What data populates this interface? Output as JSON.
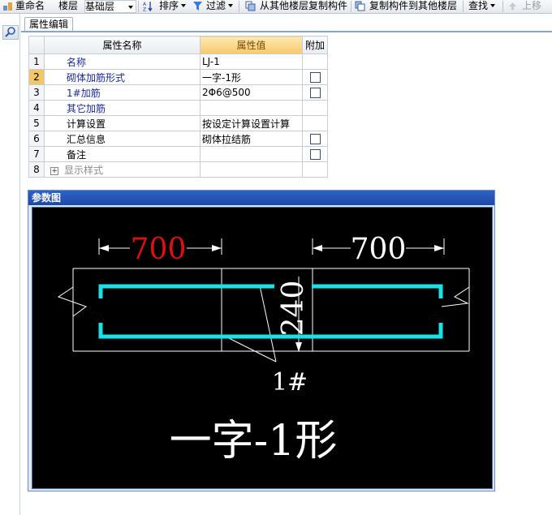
{
  "toolbar": {
    "rename": "重命名",
    "floor_label": "楼层",
    "floor_value": "基础层",
    "sort": "排序",
    "filter": "过滤",
    "copy_from": "从其他楼层复制构件",
    "copy_to": "复制构件到其他楼层",
    "find": "查找",
    "move_up": "上移"
  },
  "tab": {
    "label": "属性编辑"
  },
  "grid": {
    "headers": {
      "name": "属性名称",
      "value": "属性值",
      "extra": "附加"
    },
    "rows": [
      {
        "num": "1",
        "name": "名称",
        "value": "LJ-1",
        "extra": false
      },
      {
        "num": "2",
        "name": "砌体加筋形式",
        "value": "一字-1形",
        "extra": true
      },
      {
        "num": "3",
        "name": "1#加筋",
        "value": "2Φ6@500",
        "extra": true
      },
      {
        "num": "4",
        "name": "其它加筋",
        "value": "",
        "extra": false
      },
      {
        "num": "5",
        "name": "计算设置",
        "value": "按设定计算设置计算",
        "extra": false
      },
      {
        "num": "6",
        "name": "汇总信息",
        "value": "砌体拉结筋",
        "extra": true
      },
      {
        "num": "7",
        "name": "备注",
        "value": "",
        "extra": true
      },
      {
        "num": "8",
        "name": "显示样式",
        "value": "",
        "extra": false
      }
    ]
  },
  "param": {
    "title": "参数图",
    "dim_left": "700",
    "dim_right": "700",
    "dim_thickness": "240",
    "bar_label": "1#",
    "shape_label": "一字-1形",
    "colors": {
      "dim_left": "#e01010",
      "rebar": "#19e2e6",
      "lines": "#ffffff"
    }
  }
}
